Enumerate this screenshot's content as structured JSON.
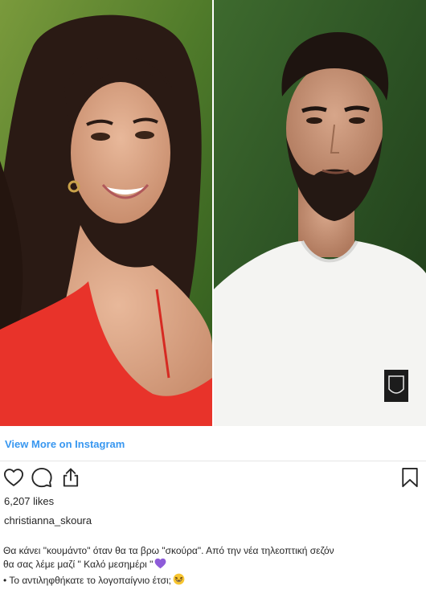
{
  "media": {
    "left_photo_alt": "christianna_skoura",
    "right_photo_alt": ""
  },
  "link": {
    "view_more": "View More on Instagram"
  },
  "actions": {
    "like_icon": "heart-outline",
    "comment_icon": "speech-bubble",
    "share_icon": "share-arrow",
    "save_icon": "bookmark-outline"
  },
  "likes": "6,207 likes",
  "username": "christianna_skoura",
  "caption": {
    "line1": "Θα κάνει \"κουμάντο\" όταν θα τα βρω \"σκούρα\". Από την νέα τηλεοπτική σεζόν",
    "line2": "θα σας λέμε μαζί \" Καλό μεσημέρι \"",
    "line3": "• Το αντιληφθήκατε το λογοπαίγνιο έτσι;"
  },
  "colors": {
    "link": "#3897f0",
    "text": "#262626",
    "heart_emoji": "#8e5cd9",
    "divider": "#e6e6e6"
  }
}
